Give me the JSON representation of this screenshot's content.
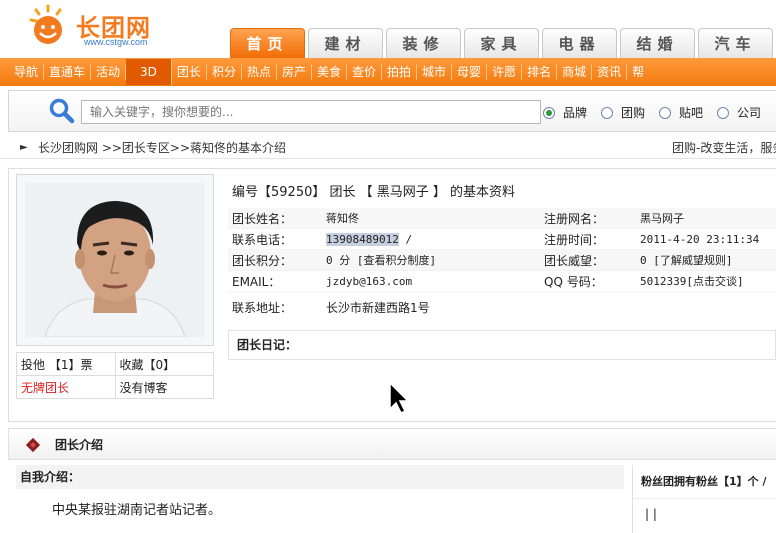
{
  "logo": {
    "brand": "长团网",
    "url": "www.cstgw.com"
  },
  "main_tabs": [
    "首页",
    "建材",
    "装修",
    "家具",
    "电器",
    "结婚",
    "汽车"
  ],
  "subnav": [
    "导航",
    "直通车",
    "活动",
    "3D",
    "团长",
    "积分",
    "热点",
    "房产",
    "美食",
    "查价",
    "拍拍",
    "城市",
    "母婴",
    "许愿",
    "排名",
    "商城",
    "资讯",
    "帮"
  ],
  "search": {
    "placeholder": "输入关键字，搜你想要的...",
    "options": [
      "品牌",
      "团购",
      "贴吧",
      "公司"
    ],
    "selected": "品牌"
  },
  "breadcrumb": {
    "path": "长沙团购网 >>团长专区>>蒋知佟的基本介绍",
    "slogan": "团购-改变生活，服务"
  },
  "profile": {
    "title": "编号【59250】 团长 【 黑马网子 】 的基本资料",
    "fields": {
      "name_label": "团长姓名：",
      "name": "蒋知佟",
      "regname_label": "注册网名：",
      "regname": "黑马网子",
      "phone_label": "联系电话：",
      "phone": "13908489012",
      "phone_suffix": " /",
      "regtime_label": "注册时间：",
      "regtime": "2011-4-20 23:11:34",
      "points_label": "团长积分：",
      "points": "0 分 [查看积分制度]",
      "prestige_label": "团长威望：",
      "prestige": "0 [了解威望规则]",
      "email_label": "EMAIL：",
      "email": "jzdyb@163.com",
      "qq_label": "QQ 号码：",
      "qq": "5012339[点击交谈]",
      "address_label": "联系地址：",
      "address": "长沙市新建西路1号"
    },
    "diary_label": "团长日记：",
    "stats": {
      "vote": "投他 【1】票",
      "collect": "收藏【0】",
      "brand_status": "无牌团长",
      "blog": "没有博客"
    }
  },
  "intro": {
    "header": "团长介绍",
    "self_label": "自我介绍：",
    "self_text": "中央某报驻湖南记者站记者。",
    "fans_label": "粉丝团拥有粉丝【1】个 /",
    "fans_bars": "| |"
  },
  "colors": {
    "accent": "#f27a0e",
    "link_red": "#dd2222"
  }
}
